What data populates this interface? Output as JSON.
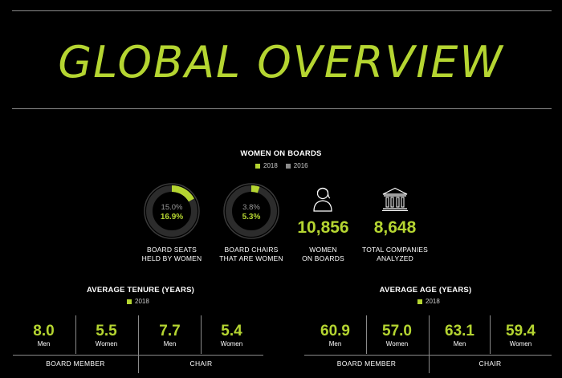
{
  "title": "GLOBAL OVERVIEW",
  "colors": {
    "accent": "#b5d531",
    "secondary": "#8c8c8c",
    "track": "#2c2c2c",
    "rule": "#8a8a8a"
  },
  "women_on_boards": {
    "heading": "WOMEN ON BOARDS",
    "legend": [
      {
        "label": "2018",
        "color": "#b5d531"
      },
      {
        "label": "2016",
        "color": "#8c8c8c"
      }
    ],
    "seats": {
      "v2016": "15.0%",
      "v2018": "16.9%",
      "caption1": "BOARD SEATS",
      "caption2": "HELD BY WOMEN"
    },
    "chairs": {
      "v2016": "3.8%",
      "v2018": "5.3%",
      "caption1": "BOARD CHAIRS",
      "caption2": "THAT ARE WOMEN"
    },
    "women_count": {
      "value": "10,856",
      "caption1": "WOMEN",
      "caption2": "ON BOARDS",
      "icon": "woman-icon"
    },
    "companies": {
      "value": "8,648",
      "caption1": "TOTAL COMPANIES",
      "caption2": "ANALYZED",
      "icon": "building-icon"
    }
  },
  "tenure": {
    "heading": "AVERAGE TENURE (YEARS)",
    "legend": "2018",
    "board_label": "BOARD MEMBER",
    "chair_label": "CHAIR",
    "cells": [
      {
        "value": "8.0",
        "label": "Men"
      },
      {
        "value": "5.5",
        "label": "Women"
      },
      {
        "value": "7.7",
        "label": "Men"
      },
      {
        "value": "5.4",
        "label": "Women"
      }
    ]
  },
  "age": {
    "heading": "AVERAGE AGE (YEARS)",
    "legend": "2018",
    "board_label": "BOARD MEMBER",
    "chair_label": "CHAIR",
    "cells": [
      {
        "value": "60.9",
        "label": "Men"
      },
      {
        "value": "57.0",
        "label": "Women"
      },
      {
        "value": "63.1",
        "label": "Men"
      },
      {
        "value": "59.4",
        "label": "Women"
      }
    ]
  },
  "chart_data": [
    {
      "type": "pie",
      "title": "BOARD SEATS HELD BY WOMEN",
      "series": [
        {
          "name": "2016",
          "values": [
            15.0
          ]
        },
        {
          "name": "2018",
          "values": [
            16.9
          ]
        }
      ]
    },
    {
      "type": "pie",
      "title": "BOARD CHAIRS THAT ARE WOMEN",
      "series": [
        {
          "name": "2016",
          "values": [
            3.8
          ]
        },
        {
          "name": "2018",
          "values": [
            5.3
          ]
        }
      ]
    },
    {
      "type": "table",
      "title": "AVERAGE TENURE (YEARS)",
      "categories": [
        "Men",
        "Women",
        "Men",
        "Women"
      ],
      "groups": [
        "BOARD MEMBER",
        "BOARD MEMBER",
        "CHAIR",
        "CHAIR"
      ],
      "series": [
        {
          "name": "2018",
          "values": [
            8.0,
            5.5,
            7.7,
            5.4
          ]
        }
      ]
    },
    {
      "type": "table",
      "title": "AVERAGE AGE (YEARS)",
      "categories": [
        "Men",
        "Women",
        "Men",
        "Women"
      ],
      "groups": [
        "BOARD MEMBER",
        "BOARD MEMBER",
        "CHAIR",
        "CHAIR"
      ],
      "series": [
        {
          "name": "2018",
          "values": [
            60.9,
            57.0,
            63.1,
            59.4
          ]
        }
      ]
    }
  ]
}
